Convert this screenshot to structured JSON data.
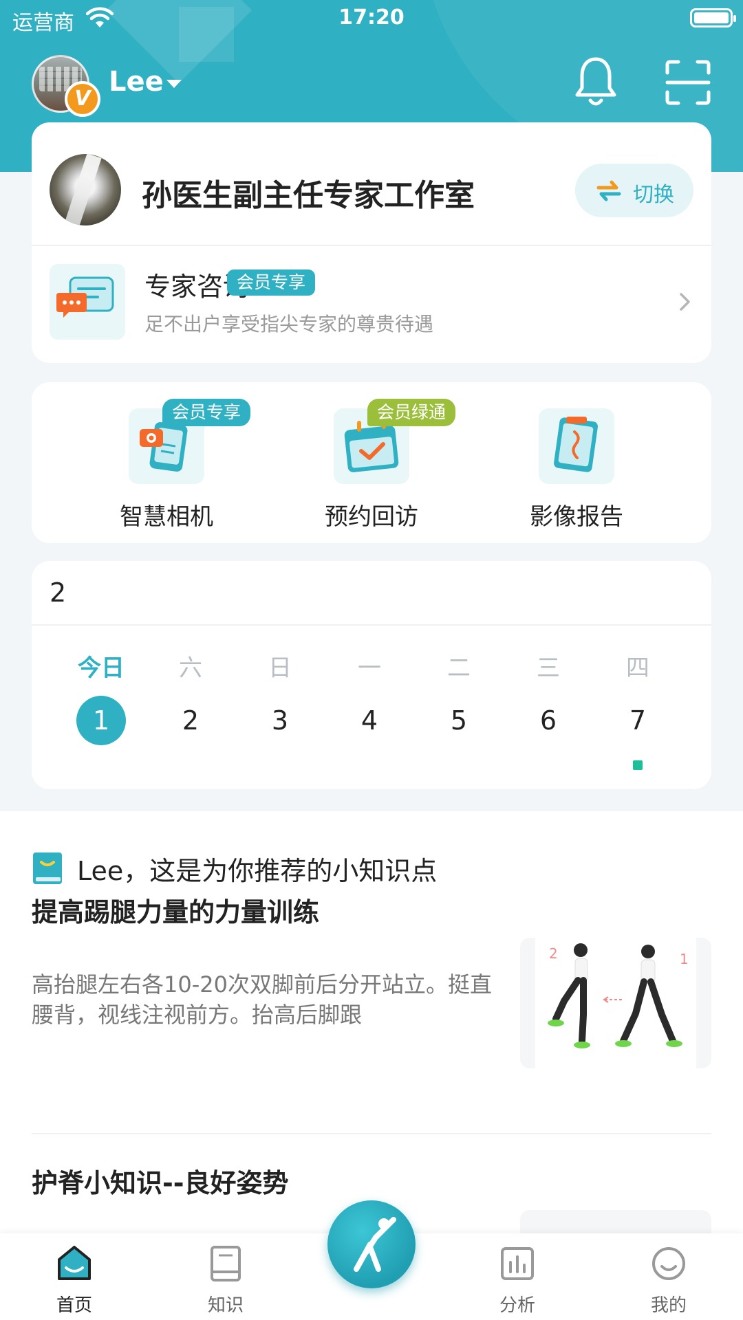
{
  "status_bar": {
    "carrier": "运营商",
    "time": "17:20"
  },
  "user": {
    "name": "Lee",
    "vip_badge": "V"
  },
  "studio": {
    "title": "孙医生副主任专家工作室",
    "switch_label": "切换",
    "consult": {
      "title": "专家咨询",
      "tag": "会员专享",
      "subtitle": "足不出户享受指尖专家的尊贵待遇"
    }
  },
  "quick_actions": [
    {
      "label": "智慧相机",
      "tag": "会员专享",
      "tag_color": "#2fb0c3",
      "icon": "smart-camera-icon"
    },
    {
      "label": "预约回访",
      "tag": "会员绿通",
      "tag_color": "#9bbf3a",
      "icon": "appointment-calendar-icon"
    },
    {
      "label": "影像报告",
      "tag": "",
      "icon": "image-report-icon"
    }
  ],
  "calendar": {
    "header": "2",
    "days": [
      {
        "weekday": "今日",
        "date": "1",
        "today": true
      },
      {
        "weekday": "六",
        "date": "2"
      },
      {
        "weekday": "日",
        "date": "3"
      },
      {
        "weekday": "一",
        "date": "4"
      },
      {
        "weekday": "二",
        "date": "5"
      },
      {
        "weekday": "三",
        "date": "6"
      },
      {
        "weekday": "四",
        "date": "7",
        "has_event": true
      }
    ]
  },
  "recommend": {
    "title": "Lee，这是为你推荐的小知识点",
    "articles": [
      {
        "title": "提高踢腿力量的力量训练",
        "desc": "高抬腿左右各10-20次双脚前后分开站立。挺直腰背，视线注视前方。抬高后脚跟",
        "thumb_numbers": [
          "2",
          "1"
        ]
      },
      {
        "title": "护脊小知识--良好姿势",
        "desc": ""
      }
    ]
  },
  "tab_bar": {
    "items": [
      {
        "label": "首页",
        "active": true
      },
      {
        "label": "知识"
      },
      {
        "label": "分析"
      },
      {
        "label": "我的"
      }
    ]
  },
  "colors": {
    "primary": "#2fb0c3",
    "orange": "#f39a1e",
    "green_tag": "#9bbf3a",
    "event_dot": "#1dbf9b"
  }
}
